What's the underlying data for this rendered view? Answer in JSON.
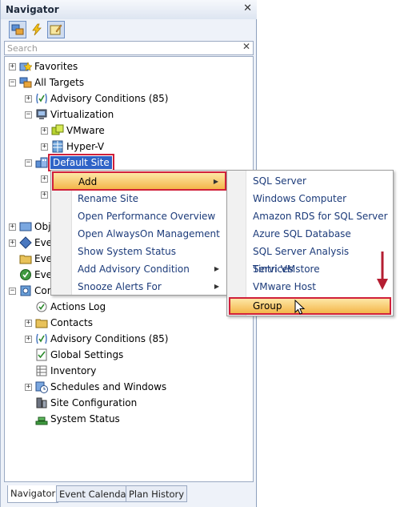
{
  "navigator": {
    "title": "Navigator",
    "close": "✕",
    "search_placeholder": "Search",
    "search_clear": "✕"
  },
  "tree": {
    "favorites": "Favorites",
    "all_targets": "All Targets",
    "advisory_conditions": "Advisory Conditions (85)",
    "virtualization": "Virtualization",
    "vmware": "VMware",
    "hyperv": "Hyper-V",
    "default_site": "Default Site",
    "obj": "Obj",
    "eve1": "Eve",
    "eve2": "Eve",
    "eve3": "Eve",
    "con": "Cor",
    "actions_log": "Actions Log",
    "contacts": "Contacts",
    "advisory_conditions_2": "Advisory Conditions (85)",
    "global_settings": "Global Settings",
    "inventory": "Inventory",
    "schedules_windows": "Schedules and Windows",
    "site_configuration": "Site Configuration",
    "system_status": "System Status"
  },
  "context_menu": {
    "items": [
      "Add",
      "Rename Site",
      "Open Performance Overview",
      "Open AlwaysOn Management",
      "Show System Status",
      "Add Advisory Condition",
      "Snooze Alerts For"
    ]
  },
  "submenu": {
    "items": [
      "SQL Server",
      "Windows Computer",
      "Amazon RDS for SQL Server",
      "Azure SQL Database",
      "SQL Server Analysis Services",
      "Tintri VMstore",
      "VMware Host",
      "Group"
    ]
  },
  "tabs": [
    "Navigator",
    "Event Calendar",
    "Plan History"
  ],
  "colors": {
    "accent_red": "#d0203a",
    "selection_blue": "#2f63c7",
    "highlight_orange": "#f4b64a",
    "menu_text": "#1c3b7a"
  }
}
